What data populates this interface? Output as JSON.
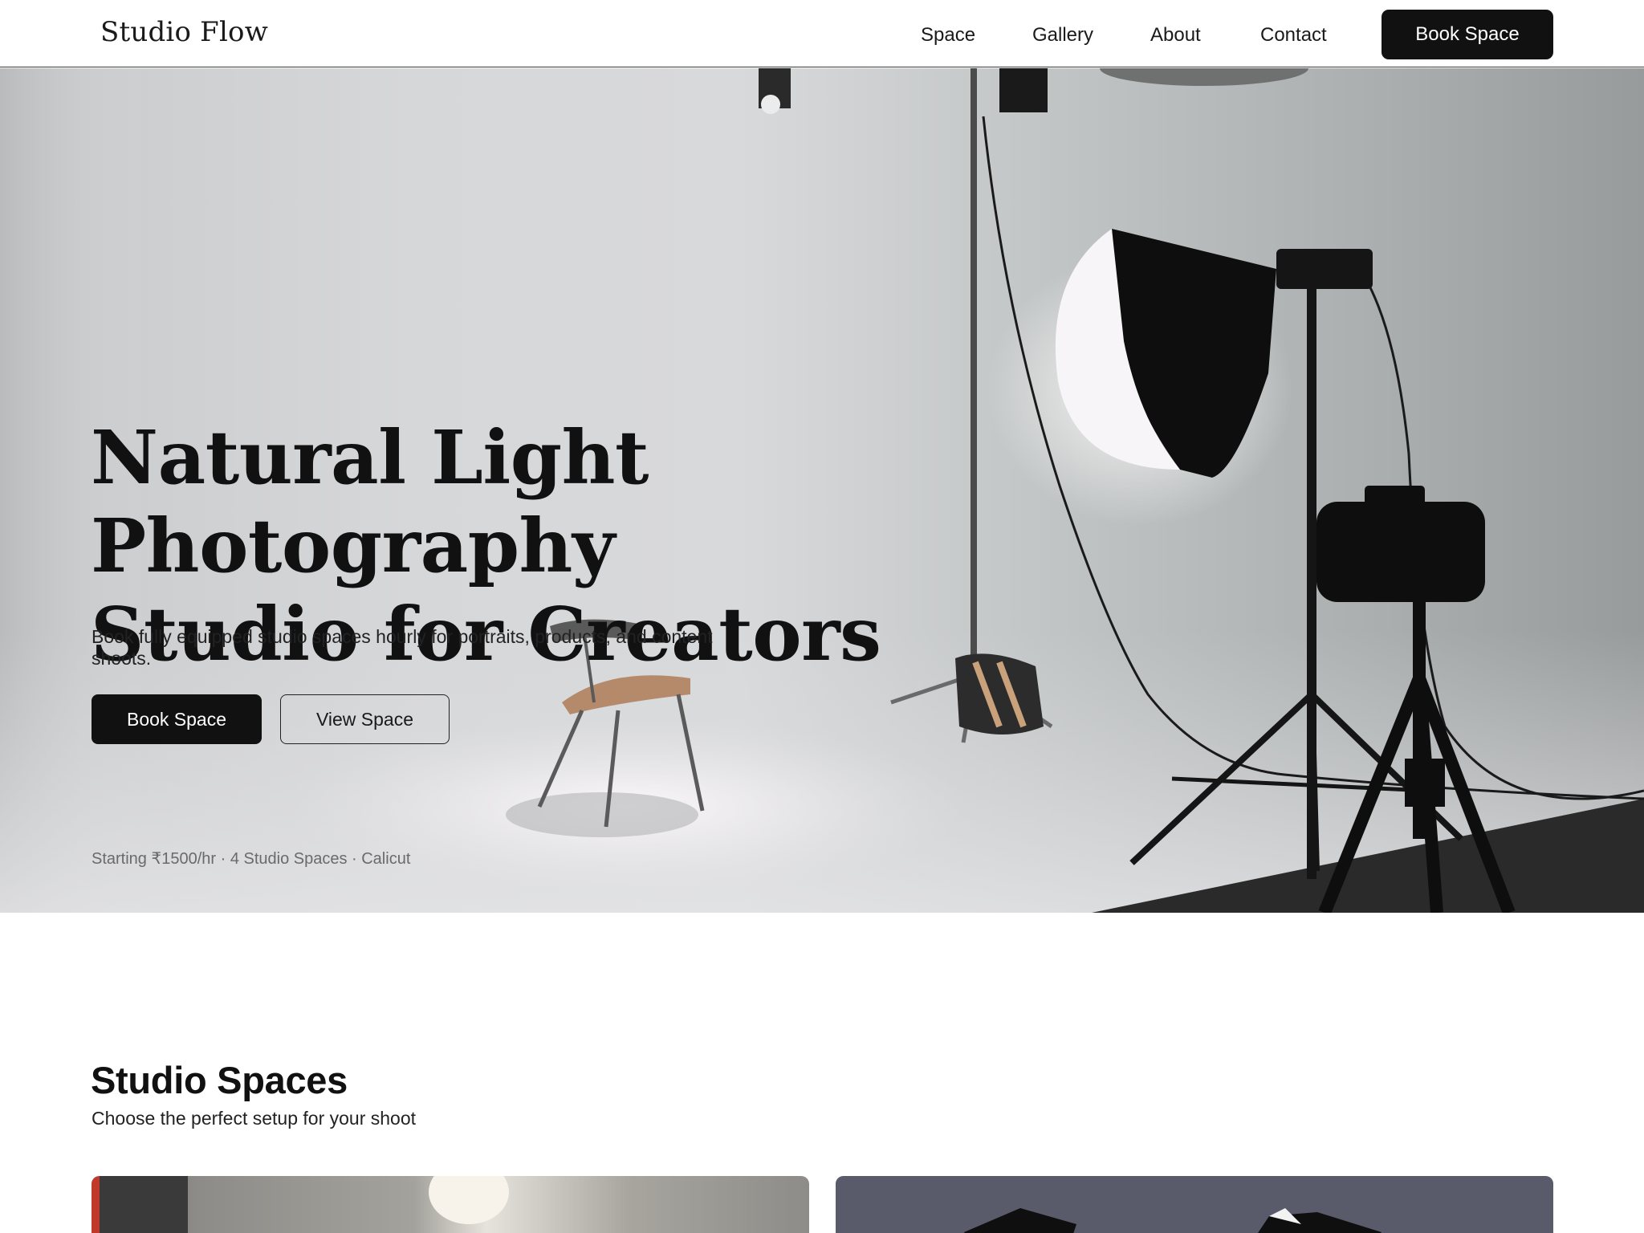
{
  "header": {
    "brand": "Studio Flow",
    "nav": [
      "Space",
      "Gallery",
      "About",
      "Contact"
    ],
    "cta_label": "Book Space"
  },
  "hero": {
    "title_lines": [
      "Natural Light",
      "Photography",
      "Studio for Creators"
    ],
    "subtitle": "Book fully equipped studio spaces hourly for portraits, products, and content shoots.",
    "primary_cta": "Book Space",
    "secondary_cta": "View Space",
    "meta": "Starting ₹1500/hr · 4 Studio Spaces · Calicut"
  },
  "spaces": {
    "title": "Studio Spaces",
    "subtitle": "Choose the perfect setup for your shoot"
  },
  "colors": {
    "primary_button": "#111111",
    "text": "#141414",
    "muted_text": "#6a6a6a"
  }
}
